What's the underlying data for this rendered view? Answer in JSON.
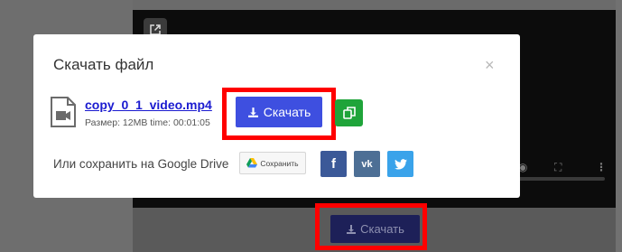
{
  "modal": {
    "title": "Скачать файл",
    "close_glyph": "×",
    "file": {
      "name": "copy_0_1_video.mp4",
      "meta": "Размер: 12MB   time: 00:01:05"
    },
    "download_label": "Скачать",
    "gdrive": {
      "text": "Или сохранить на Google Drive",
      "save_label": "Сохранить"
    },
    "social": {
      "facebook": "f",
      "vk": "vk"
    }
  },
  "background": {
    "download_label": "Скачать"
  },
  "colors": {
    "download": "#3e4fe0",
    "copy": "#1fa43a",
    "facebook": "#3b5998",
    "vk": "#4d6f95",
    "twitter": "#3aa3ea",
    "highlight": "#ff0000",
    "file_link": "#1b1bd0"
  },
  "icons": {
    "share": "share-external-icon",
    "bookmark": "bookmark-icon",
    "file": "video-file-icon",
    "download": "download-icon",
    "copy": "copy-icon",
    "gdrive": "google-drive-icon",
    "twitter": "twitter-bird-icon"
  }
}
